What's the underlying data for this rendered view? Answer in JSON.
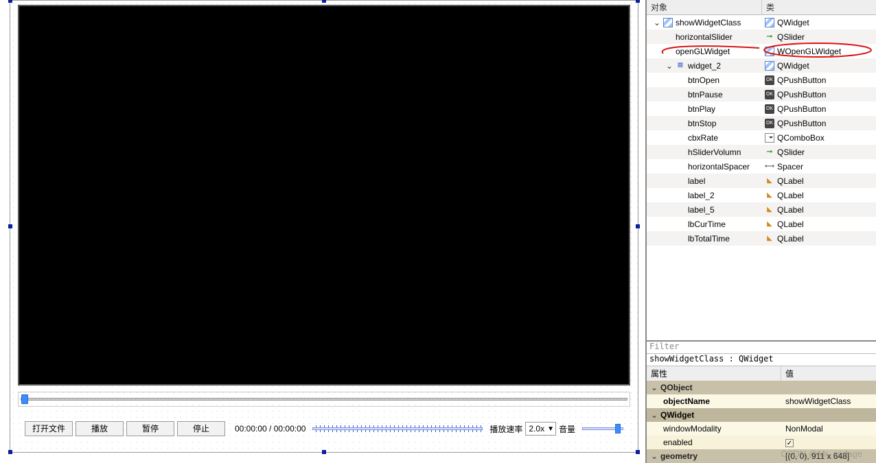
{
  "panels": {
    "object_header": "对象",
    "class_header": "类",
    "filter_placeholder": "Filter",
    "prop_title": "showWidgetClass : QWidget",
    "prop_header_key": "属性",
    "prop_header_val": "值",
    "watermark": "CSDN @Mr_codage"
  },
  "controls": {
    "btn_open": "打开文件",
    "btn_play": "播放",
    "btn_pause": "暂停",
    "btn_stop": "停止",
    "cur_time": "00:00:00",
    "sep": " / ",
    "total_time": "00:00:00",
    "rate_label": "播放速率",
    "rate_value": "2.0x",
    "vol_label": "音量"
  },
  "tree": [
    {
      "depth": 0,
      "chev": "v",
      "name": "showWidgetClass",
      "icon": "icon-widget",
      "class": "QWidget",
      "cicon": "icon-widget"
    },
    {
      "depth": 1,
      "chev": "",
      "name": "horizontalSlider",
      "icon": null,
      "class": "QSlider",
      "cicon": "icon-slider"
    },
    {
      "depth": 1,
      "chev": "",
      "name": "openGLWidget",
      "icon": null,
      "class": "WOpenGLWidget",
      "cicon": "icon-widget",
      "highlight": true
    },
    {
      "depth": 1,
      "chev": "v",
      "name": "widget_2",
      "icon": "icon-container",
      "class": "QWidget",
      "cicon": "icon-widget"
    },
    {
      "depth": 2,
      "chev": "",
      "name": "btnOpen",
      "icon": null,
      "class": "QPushButton",
      "cicon": "icon-button"
    },
    {
      "depth": 2,
      "chev": "",
      "name": "btnPause",
      "icon": null,
      "class": "QPushButton",
      "cicon": "icon-button"
    },
    {
      "depth": 2,
      "chev": "",
      "name": "btnPlay",
      "icon": null,
      "class": "QPushButton",
      "cicon": "icon-button"
    },
    {
      "depth": 2,
      "chev": "",
      "name": "btnStop",
      "icon": null,
      "class": "QPushButton",
      "cicon": "icon-button"
    },
    {
      "depth": 2,
      "chev": "",
      "name": "cbxRate",
      "icon": null,
      "class": "QComboBox",
      "cicon": "icon-combo"
    },
    {
      "depth": 2,
      "chev": "",
      "name": "hSliderVolumn",
      "icon": null,
      "class": "QSlider",
      "cicon": "icon-slider"
    },
    {
      "depth": 2,
      "chev": "",
      "name": "horizontalSpacer",
      "icon": null,
      "class": "Spacer",
      "cicon": "icon-spacer"
    },
    {
      "depth": 2,
      "chev": "",
      "name": "label",
      "icon": null,
      "class": "QLabel",
      "cicon": "icon-label"
    },
    {
      "depth": 2,
      "chev": "",
      "name": "label_2",
      "icon": null,
      "class": "QLabel",
      "cicon": "icon-label"
    },
    {
      "depth": 2,
      "chev": "",
      "name": "label_5",
      "icon": null,
      "class": "QLabel",
      "cicon": "icon-label"
    },
    {
      "depth": 2,
      "chev": "",
      "name": "lbCurTime",
      "icon": null,
      "class": "QLabel",
      "cicon": "icon-label"
    },
    {
      "depth": 2,
      "chev": "",
      "name": "lbTotalTime",
      "icon": null,
      "class": "QLabel",
      "cicon": "icon-label"
    }
  ],
  "properties": [
    {
      "kind": "group",
      "key": "QObject",
      "chev": "v"
    },
    {
      "kind": "row",
      "key": "objectName",
      "val": "showWidgetClass"
    },
    {
      "kind": "group",
      "key": "QWidget",
      "chev": "v",
      "alt": true
    },
    {
      "kind": "row",
      "key": "windowModality",
      "val": "NonModal"
    },
    {
      "kind": "row",
      "key": "enabled",
      "val_check": true
    },
    {
      "kind": "group2",
      "key": "geometry",
      "chev": "v",
      "val": "[(0, 0), 911 x 648]"
    }
  ]
}
